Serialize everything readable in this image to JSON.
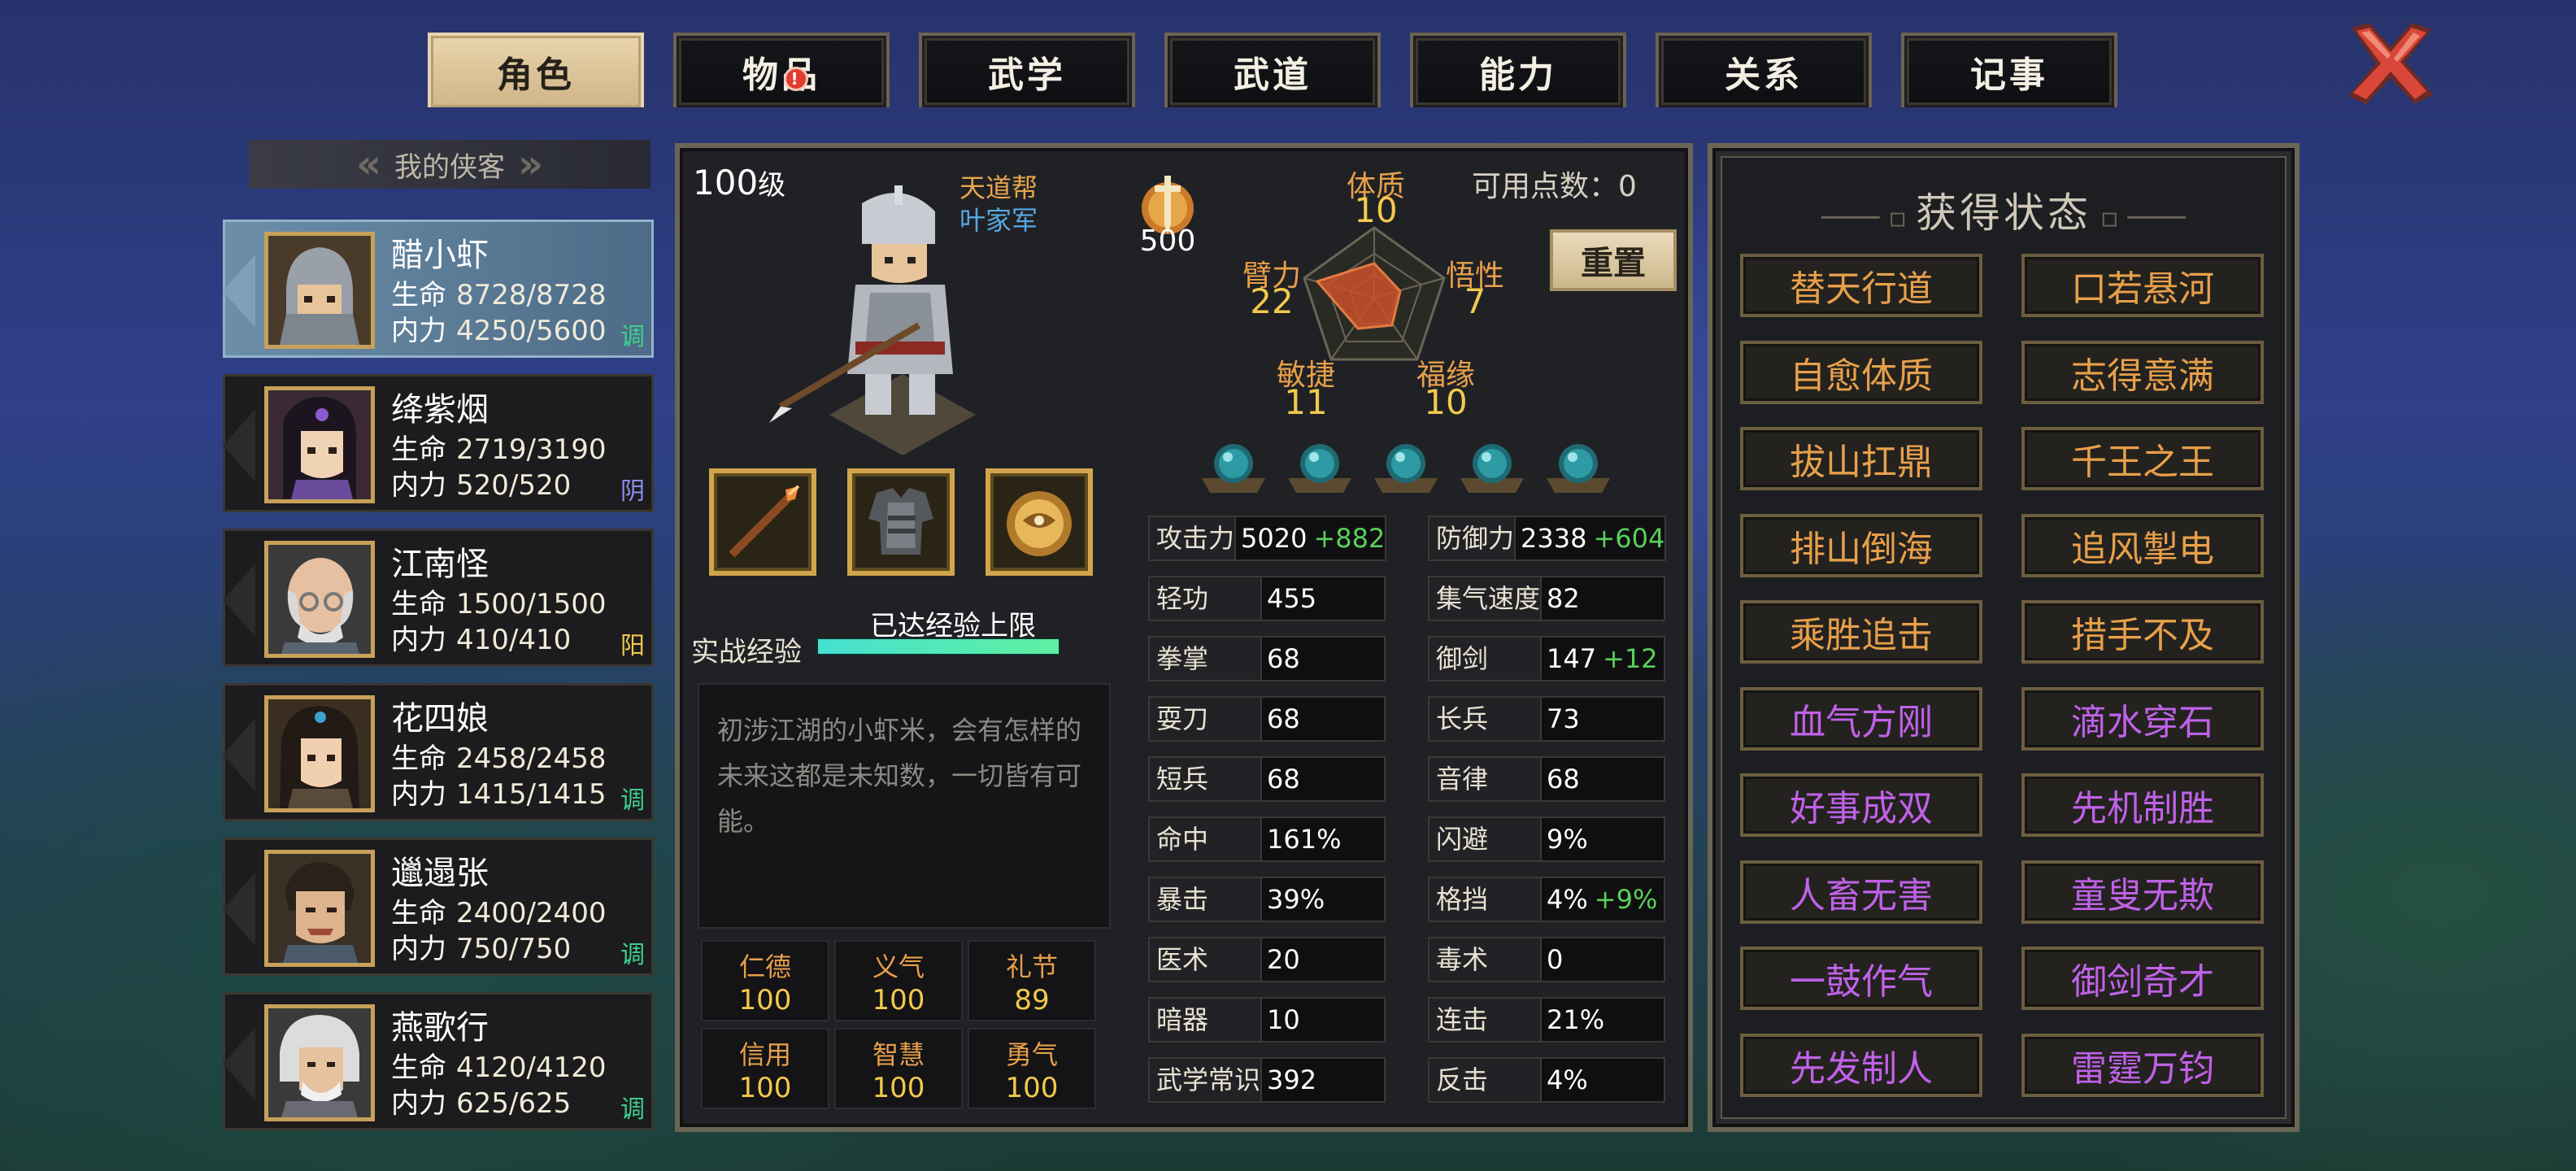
{
  "tabs": [
    {
      "label": "角色",
      "active": true
    },
    {
      "label": "物品",
      "badge": "!"
    },
    {
      "label": "武学"
    },
    {
      "label": "武道"
    },
    {
      "label": "能力"
    },
    {
      "label": "关系"
    },
    {
      "label": "记事"
    }
  ],
  "roster": {
    "header": "我的侠客",
    "characters": [
      {
        "name": "醋小虾",
        "hp_label": "生命",
        "hp": "8728/8728",
        "mp_label": "内力",
        "mp": "4250/5600",
        "tag": "调",
        "tag_color": "#3fcf8e"
      },
      {
        "name": "绛紫烟",
        "hp_label": "生命",
        "hp": "2719/3190",
        "mp_label": "内力",
        "mp": "520/520",
        "tag": "阴",
        "tag_color": "#8f8cf0"
      },
      {
        "name": "江南怪",
        "hp_label": "生命",
        "hp": "1500/1500",
        "mp_label": "内力",
        "mp": "410/410",
        "tag": "阳",
        "tag_color": "#f2c94c"
      },
      {
        "name": "花四娘",
        "hp_label": "生命",
        "hp": "2458/2458",
        "mp_label": "内力",
        "mp": "1415/1415",
        "tag": "调",
        "tag_color": "#3fcf8e"
      },
      {
        "name": "邋遢张",
        "hp_label": "生命",
        "hp": "2400/2400",
        "mp_label": "内力",
        "mp": "750/750",
        "tag": "调",
        "tag_color": "#3fcf8e"
      },
      {
        "name": "燕歌行",
        "hp_label": "生命",
        "hp": "4120/4120",
        "mp_label": "内力",
        "mp": "625/625",
        "tag": "调",
        "tag_color": "#3fcf8e"
      }
    ]
  },
  "profile": {
    "level_num": "100",
    "level_suffix": "级",
    "faction": "天道帮",
    "subfaction": "叶家军",
    "power": "500",
    "points_label": "可用点数：0",
    "reset_label": "重置",
    "attributes": {
      "tizhi": {
        "label": "体质",
        "value": "10"
      },
      "bili": {
        "label": "臂力",
        "value": "22"
      },
      "wuxing": {
        "label": "悟性",
        "value": "7"
      },
      "minjie": {
        "label": "敏捷",
        "value": "11"
      },
      "fuyuan": {
        "label": "福缘",
        "value": "10"
      }
    },
    "exp_label": "实战经验",
    "exp_text": "已达经验上限",
    "exp_progress": 1.0,
    "description": "初涉江湖的小虾米，会有怎样的未来这都是未知数，一切皆有可能。",
    "virtues": [
      {
        "label": "仁德",
        "value": "100"
      },
      {
        "label": "义气",
        "value": "100"
      },
      {
        "label": "礼节",
        "value": "89"
      },
      {
        "label": "信用",
        "value": "100"
      },
      {
        "label": "智慧",
        "value": "100"
      },
      {
        "label": "勇气",
        "value": "100"
      }
    ],
    "equipment": [
      "spear-icon",
      "armor-icon",
      "amulet-icon"
    ],
    "stats_left": [
      {
        "label": "攻击力",
        "value": "5020",
        "bonus": "+882"
      },
      {
        "label": "轻功",
        "value": "455",
        "bonus": ""
      },
      {
        "label": "拳掌",
        "value": "68",
        "bonus": ""
      },
      {
        "label": "耍刀",
        "value": "68",
        "bonus": ""
      },
      {
        "label": "短兵",
        "value": "68",
        "bonus": ""
      },
      {
        "label": "命中",
        "value": "161%",
        "bonus": ""
      },
      {
        "label": "暴击",
        "value": "39%",
        "bonus": ""
      },
      {
        "label": "医术",
        "value": "20",
        "bonus": ""
      },
      {
        "label": "暗器",
        "value": "10",
        "bonus": ""
      },
      {
        "label": "武学常识",
        "value": "392",
        "bonus": ""
      }
    ],
    "stats_right": [
      {
        "label": "防御力",
        "value": "2338",
        "bonus": "+604"
      },
      {
        "label": "集气速度",
        "value": "82",
        "bonus": ""
      },
      {
        "label": "御剑",
        "value": "147",
        "bonus": "+12"
      },
      {
        "label": "长兵",
        "value": "73",
        "bonus": ""
      },
      {
        "label": "音律",
        "value": "68",
        "bonus": ""
      },
      {
        "label": "闪避",
        "value": "9%",
        "bonus": ""
      },
      {
        "label": "格挡",
        "value": "4%",
        "bonus": "+9%"
      },
      {
        "label": "毒术",
        "value": "0",
        "bonus": ""
      },
      {
        "label": "连击",
        "value": "21%",
        "bonus": ""
      },
      {
        "label": "反击",
        "value": "4%",
        "bonus": ""
      }
    ]
  },
  "status": {
    "title": "获得状态",
    "items": [
      {
        "label": "替天行道",
        "color": "#e8a04a"
      },
      {
        "label": "口若悬河",
        "color": "#e8a04a"
      },
      {
        "label": "自愈体质",
        "color": "#e8a04a"
      },
      {
        "label": "志得意满",
        "color": "#e8a04a"
      },
      {
        "label": "拔山扛鼎",
        "color": "#e8a04a"
      },
      {
        "label": "千王之王",
        "color": "#e8a04a"
      },
      {
        "label": "排山倒海",
        "color": "#e8a04a"
      },
      {
        "label": "追风掣电",
        "color": "#e8a04a"
      },
      {
        "label": "乘胜追击",
        "color": "#e8a04a"
      },
      {
        "label": "措手不及",
        "color": "#e8a04a"
      },
      {
        "label": "血气方刚",
        "color": "#c061e8"
      },
      {
        "label": "滴水穿石",
        "color": "#c061e8"
      },
      {
        "label": "好事成双",
        "color": "#c061e8"
      },
      {
        "label": "先机制胜",
        "color": "#c061e8"
      },
      {
        "label": "人畜无害",
        "color": "#c061e8"
      },
      {
        "label": "童叟无欺",
        "color": "#c061e8"
      },
      {
        "label": "一鼓作气",
        "color": "#c061e8"
      },
      {
        "label": "御剑奇才",
        "color": "#c061e8"
      },
      {
        "label": "先发制人",
        "color": "#c061e8"
      },
      {
        "label": "雷霆万钧",
        "color": "#c061e8"
      }
    ]
  }
}
